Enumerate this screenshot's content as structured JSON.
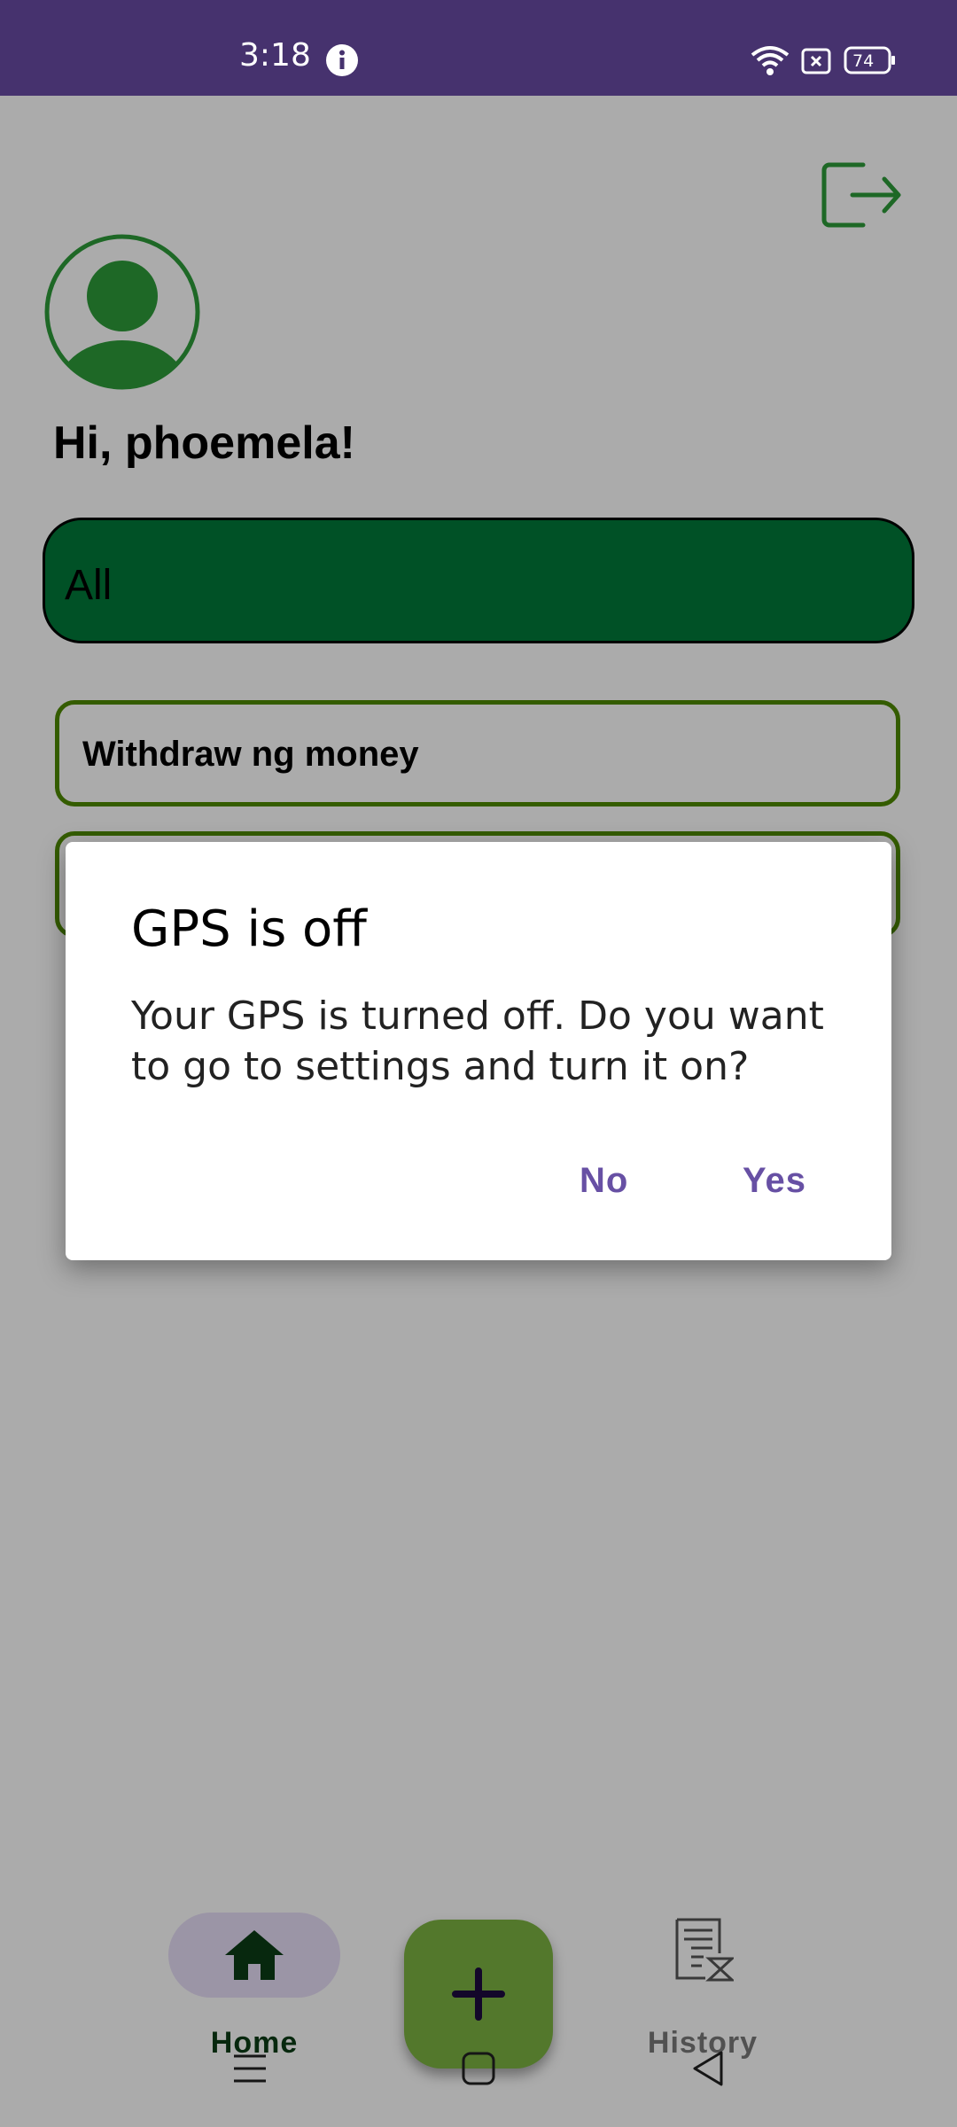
{
  "status_bar": {
    "time": "3:18",
    "battery": "74"
  },
  "header": {
    "greeting": "Hi, phoemela!"
  },
  "filter": {
    "selected": "All"
  },
  "list": {
    "items": [
      {
        "label": "Withdraw ng money"
      },
      {
        "label": ""
      }
    ]
  },
  "bottom_nav": {
    "home_label": "Home",
    "history_label": "History"
  },
  "dialog": {
    "title": "GPS is off",
    "message": "Your GPS is turned off. Do you want to go to settings and turn it on?",
    "no_label": "No",
    "yes_label": "Yes"
  },
  "colors": {
    "status_bar": "#46326e",
    "accent_green": "#007a3a",
    "item_border": "#4e8a00",
    "fab": "#7cb342",
    "dialog_button": "#6750a4"
  }
}
